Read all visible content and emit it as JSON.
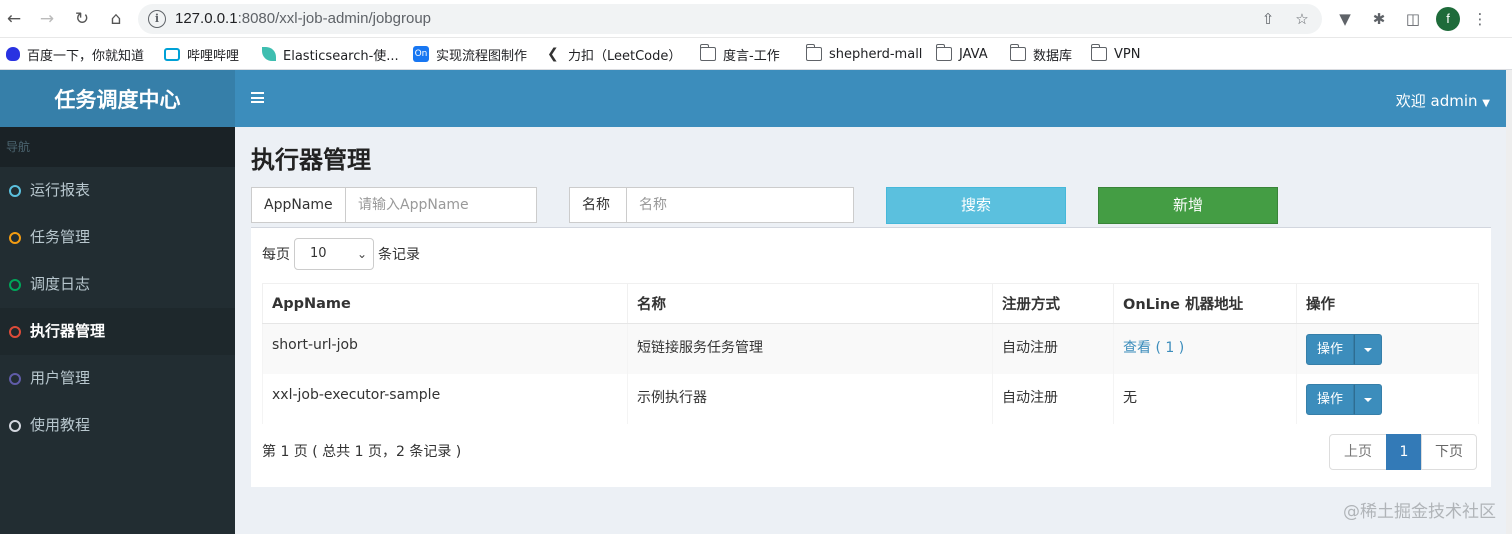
{
  "browser": {
    "url_host": "127.0.0.1",
    "url_rest": ":8080/xxl-job-admin/jobgroup",
    "avatar_letter": "f",
    "bookmarks": [
      {
        "label": "百度一下，你就知道",
        "icon": "baidu-paw-icon"
      },
      {
        "label": "哔哩哔哩",
        "icon": "bilibili-icon"
      },
      {
        "label": "Elasticsearch-使...",
        "icon": "elasticsearch-leaf-icon"
      },
      {
        "label": "实现流程图制作",
        "icon": "on-logo-icon"
      },
      {
        "label": "力扣（LeetCode）",
        "icon": "leetcode-icon"
      },
      {
        "label": "度言-工作",
        "icon": "folder-icon"
      },
      {
        "label": "shepherd-mall",
        "icon": "folder-icon"
      },
      {
        "label": "JAVA",
        "icon": "folder-icon"
      },
      {
        "label": "数据库",
        "icon": "folder-icon"
      },
      {
        "label": "VPN",
        "icon": "folder-icon"
      }
    ]
  },
  "app": {
    "logo": "任务调度中心",
    "user_menu": "欢迎 admin",
    "colors": {
      "header": "#3c8dbc",
      "logo": "#367fa9",
      "sidebar": "#222d32"
    }
  },
  "sidebar": {
    "header": "导航",
    "items": [
      {
        "label": "运行报表",
        "dot_color": "#5bc0de"
      },
      {
        "label": "任务管理",
        "dot_color": "#f39c12"
      },
      {
        "label": "调度日志",
        "dot_color": "#00a65a"
      },
      {
        "label": "执行器管理",
        "dot_color": "#dd4b39",
        "active": true
      },
      {
        "label": "用户管理",
        "dot_color": "#605ca8"
      },
      {
        "label": "使用教程",
        "dot_color": "#d2d6de"
      }
    ]
  },
  "page": {
    "title": "执行器管理",
    "filter": {
      "appname_label": "AppName",
      "appname_placeholder": "请输入AppName",
      "name_label": "名称",
      "name_placeholder": "名称",
      "search_button": "搜索",
      "add_button": "新增"
    },
    "length": {
      "prefix": "每页",
      "value": "10",
      "suffix": "条记录"
    },
    "table": {
      "headers": [
        "AppName",
        "名称",
        "注册方式",
        "OnLine 机器地址",
        "操作"
      ],
      "rows": [
        {
          "appname": "short-url-job",
          "name": "短链接服务任务管理",
          "reg": "自动注册",
          "online": "查看 ( 1 )",
          "online_is_link": true,
          "action": "操作"
        },
        {
          "appname": "xxl-job-executor-sample",
          "name": "示例执行器",
          "reg": "自动注册",
          "online": "无",
          "online_is_link": false,
          "action": "操作"
        }
      ]
    },
    "info": "第 1 页 ( 总共 1 页，2 条记录 )",
    "pager": {
      "prev": "上页",
      "current": "1",
      "next": "下页"
    }
  },
  "watermark": "@稀土掘金技术社区"
}
